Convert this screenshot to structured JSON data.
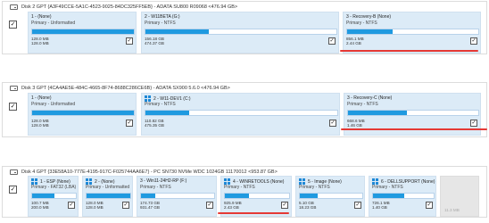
{
  "disks": [
    {
      "header": "Disk 2 GPT {A3F49CCE-5A1C-4523-9025-84DC325FF5EB} - ADATA SU800 R09068 <476.94 GB>",
      "partitions": [
        {
          "name": "1 - (None)",
          "type": "Primary - Unformatted",
          "used": "128.0 MB",
          "total": "128.0 MB",
          "fill": 1.0,
          "windows_icon": false
        },
        {
          "name": "2 - W11BETA (G:)",
          "type": "Primary - NTFS",
          "used": "156.18 GB",
          "total": "474.37 GB",
          "fill": 0.33,
          "windows_icon": false
        },
        {
          "name": "3 - Recovery-B (None)",
          "type": "Primary - NTFS",
          "used": "856.1 MB",
          "total": "2.44 GB",
          "fill": 0.35,
          "windows_icon": false
        }
      ]
    },
    {
      "header": "Disk 3 GPT {4CA4AE5E-484C-4665-8F74-8688C286CE6B} - ADATA SX900 5.6.0 <476.94 GB>",
      "partitions": [
        {
          "name": "1 - (None)",
          "type": "Primary - Unformatted",
          "used": "128.0 MB",
          "total": "128.0 MB",
          "fill": 1.0,
          "windows_icon": false
        },
        {
          "name": "2 - W11-DEV1 (C:)",
          "type": "Primary - NTFS",
          "used": "110.82 GB",
          "total": "475.35 GB",
          "fill": 0.23,
          "windows_icon": true
        },
        {
          "name": "3 - Recovery-C (None)",
          "type": "Primary - NTFS",
          "used": "668.6 MB",
          "total": "1.46 GB",
          "fill": 0.45,
          "windows_icon": false
        }
      ]
    },
    {
      "header": "Disk 4 GPT {33E58A10-777E-4195-917C-F025744AA6E7} - PC SN730 NVMe WDC 1024GB 11170012 <953.87 GB>",
      "partitions": [
        {
          "name": "1 - ESP (None)",
          "type": "Primary - FAT32 (LBA)",
          "used": "100.7 MB",
          "total": "200.0 MB",
          "fill": 0.5,
          "windows_icon": true
        },
        {
          "name": "2 - (None)",
          "type": "Primary - Unformatted",
          "used": "128.0 MB",
          "total": "128.0 MB",
          "fill": 1.0,
          "windows_icon": true
        },
        {
          "name": "3 - Win11-24H2-RP (F:)",
          "type": "Primary - NTFS",
          "used": "174.73 GB",
          "total": "931.47 GB",
          "fill": 0.19,
          "windows_icon": false
        },
        {
          "name": "4 - WINRETOOLS (None)",
          "type": "Primary - NTFS",
          "used": "925.9 MB",
          "total": "2.43 GB",
          "fill": 0.38,
          "windows_icon": true
        },
        {
          "name": "5 - Image (None)",
          "type": "Primary - NTFS",
          "used": "5.10 GB",
          "total": "18.23 GB",
          "fill": 0.28,
          "windows_icon": true
        },
        {
          "name": "6 - DELLSUPPORT (None)",
          "type": "Primary - NTFS",
          "used": "726.1 MB",
          "total": "1.40 GB",
          "fill": 0.52,
          "windows_icon": true
        }
      ],
      "unallocated": "11.3 MB"
    }
  ],
  "checkmark": "✓",
  "colors": {
    "fill": "#1f9ae0",
    "partition_bg": "#dcebf7",
    "annotation": "#e53935"
  }
}
